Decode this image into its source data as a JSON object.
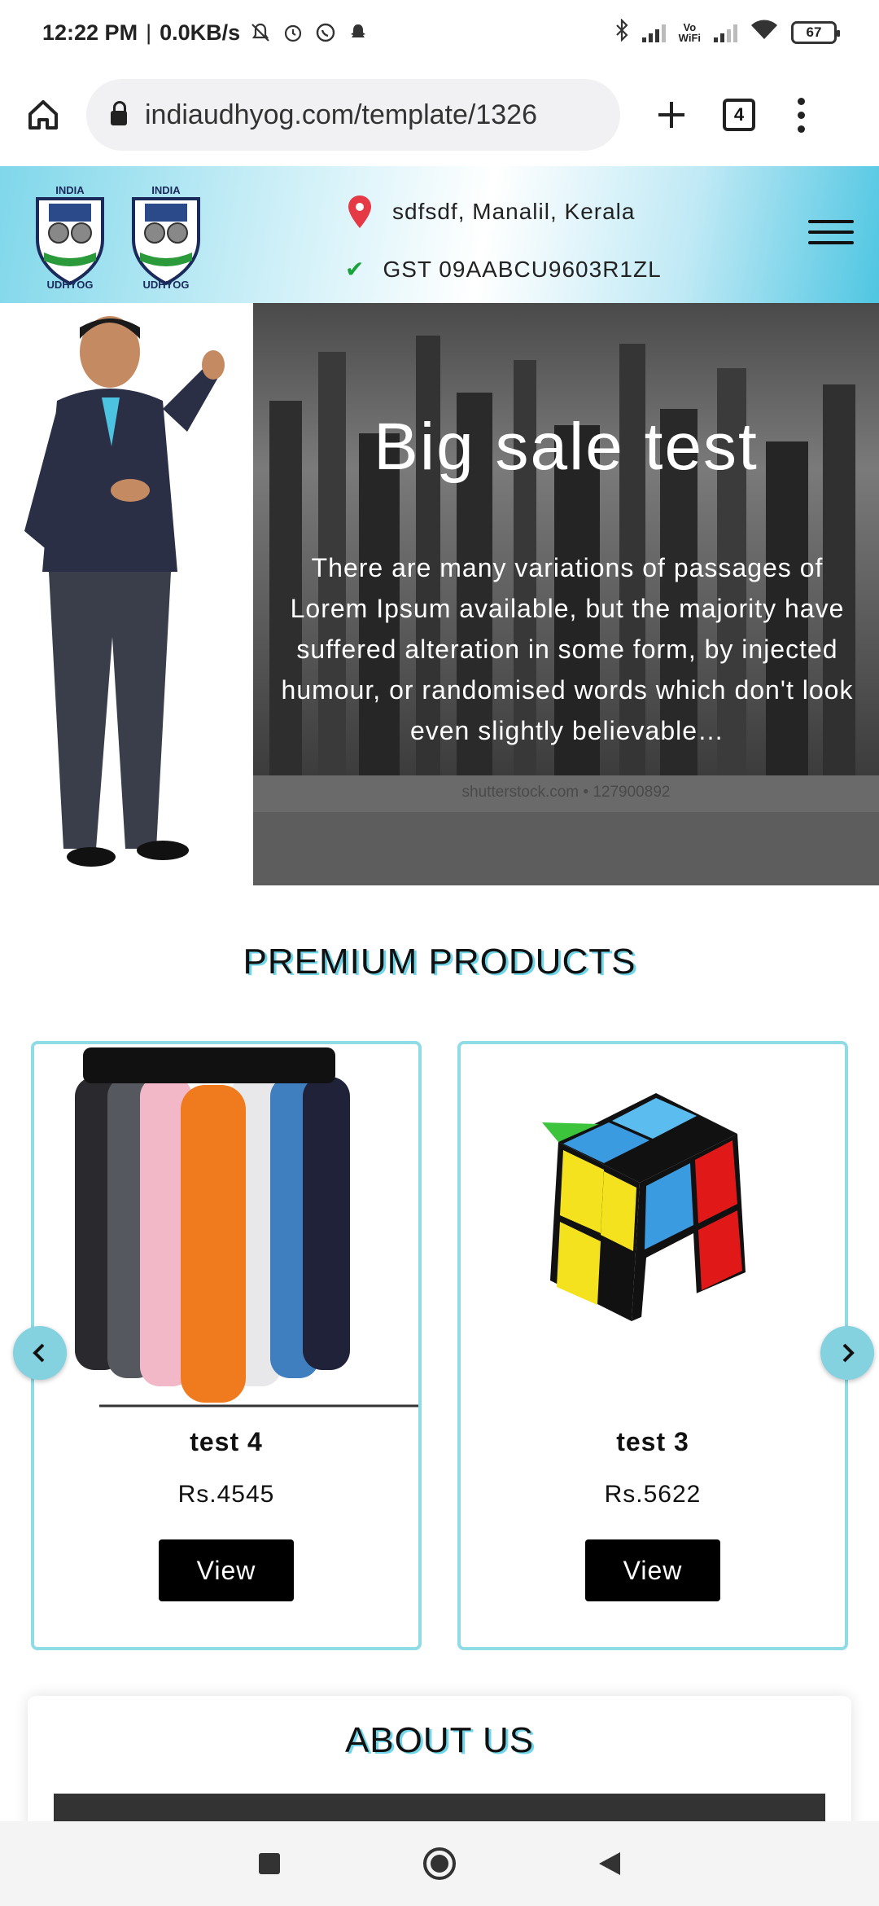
{
  "status_bar": {
    "time": "12:22 PM",
    "speed": "0.0KB/s",
    "battery": "67",
    "icons": [
      "mute-icon",
      "alarm-icon",
      "whatsapp-icon",
      "snapchat-icon",
      "bluetooth-icon",
      "signal-icon",
      "vowifi-icon",
      "wifi-icon",
      "battery-icon"
    ]
  },
  "browser": {
    "url": "indiaudhyog.com/template/1326",
    "tab_count": "4"
  },
  "header": {
    "logo_text_top": "INDIA",
    "logo_text_bottom": "UDHYOG",
    "location": "sdfsdf, Manalil, Kerala",
    "gst": "GST 09AABCU9603R1ZL"
  },
  "hero": {
    "title": "Big sale test",
    "text": "There are many variations of passages of Lorem Ipsum available, but the majority have suffered alteration in some form, by injected humour, or randomised words which don't look even slightly believable…",
    "watermark": "shutterstock.com • 127900892"
  },
  "premium": {
    "title": "PREMIUM PRODUCTS",
    "products": [
      {
        "name": "test 4",
        "price": "Rs.4545",
        "button": "View",
        "image": "water-bottles"
      },
      {
        "name": "test 3",
        "price": "Rs.5622",
        "button": "View",
        "image": "rubiks-cube"
      }
    ]
  },
  "about": {
    "title": "ABOUT US"
  },
  "colors": {
    "accent": "#6fd6ea",
    "card_border": "#8fdbe6",
    "arrow": "#84d2e0",
    "pin": "#e53945",
    "check": "#1aa33a"
  }
}
